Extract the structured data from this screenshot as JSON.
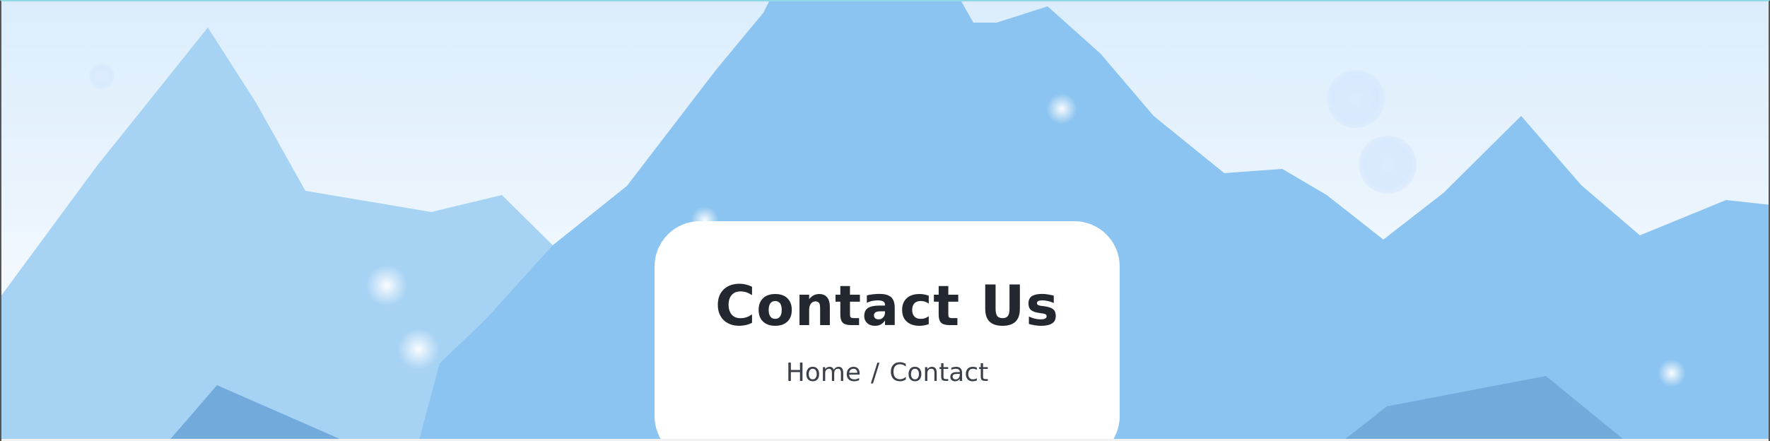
{
  "page_header": {
    "title": "Contact Us",
    "breadcrumb": {
      "home": "Home",
      "separator": "/",
      "current": "Contact"
    }
  },
  "colors": {
    "sky_top": "#dbedfc",
    "mountain_back": "#a6d2f4",
    "mountain_front": "#8bc4f0",
    "mountain_dark": "#72aadc",
    "title_text": "#23272f"
  }
}
